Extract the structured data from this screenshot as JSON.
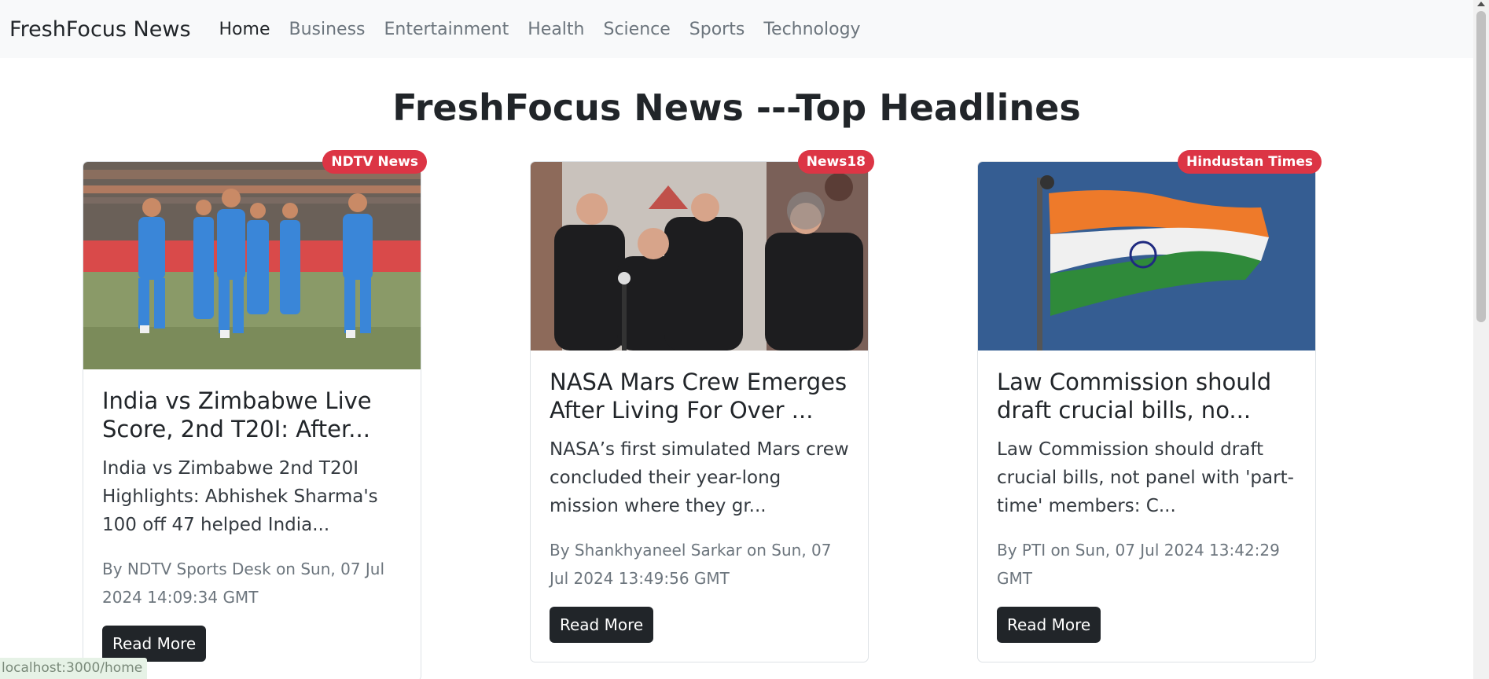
{
  "nav": {
    "brand": "FreshFocus News",
    "links": [
      "Home",
      "Business",
      "Entertainment",
      "Health",
      "Science",
      "Sports",
      "Technology"
    ]
  },
  "page": {
    "title": "FreshFocus News ---Top Headlines"
  },
  "cards": [
    {
      "source": "NDTV News",
      "title": "India vs Zimbabwe Live Score, 2nd T20I: After...",
      "description": "India vs Zimbabwe 2nd T20I Highlights: Abhishek Sharma's 100 off 47 helped India...",
      "meta": "By NDTV Sports Desk on Sun, 07 Jul 2024 14:09:34 GMT",
      "button": "Read More"
    },
    {
      "source": "News18",
      "title": "NASA Mars Crew Emerges After Living For Over ...",
      "description": "NASA’s first simulated Mars crew concluded their year-long mission where they gr...",
      "meta": "By Shankhyaneel Sarkar on Sun, 07 Jul 2024 13:49:56 GMT",
      "button": "Read More"
    },
    {
      "source": "Hindustan Times",
      "title": "Law Commission should draft crucial bills, no...",
      "description": "Law Commission should draft crucial bills, not panel with 'part-time' members: C...",
      "meta": "By PTI on Sun, 07 Jul 2024 13:42:29 GMT",
      "button": "Read More"
    }
  ],
  "status": {
    "url": "localhost:3000/home"
  },
  "colors": {
    "badge": "#dc3545",
    "button": "#212529",
    "navbar": "#f8f9fa"
  }
}
